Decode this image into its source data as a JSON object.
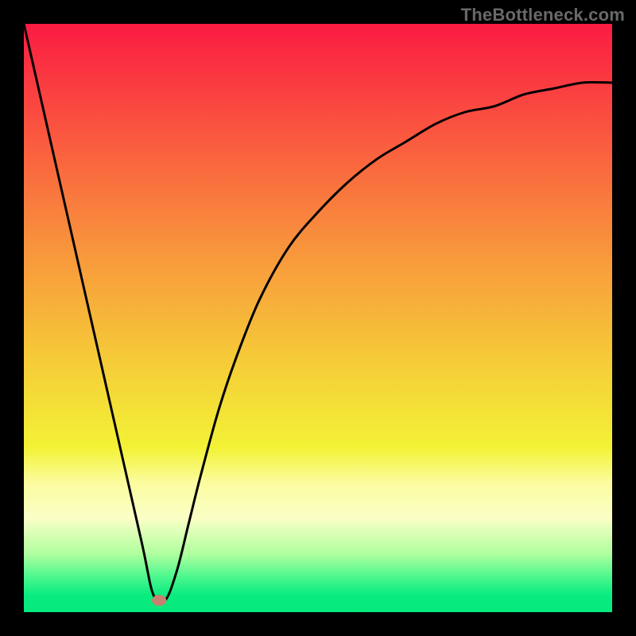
{
  "watermark": "TheBottleneck.com",
  "chart_data": {
    "type": "line",
    "title": "",
    "xlabel": "",
    "ylabel": "",
    "xlim": [
      0,
      100
    ],
    "ylim": [
      0,
      100
    ],
    "grid": false,
    "series": [
      {
        "name": "curve",
        "x": [
          0,
          5,
          10,
          15,
          20,
          22,
          24,
          26,
          28,
          30,
          33,
          36,
          40,
          45,
          50,
          55,
          60,
          65,
          70,
          75,
          80,
          85,
          90,
          95,
          100
        ],
        "y": [
          100,
          78,
          56,
          34,
          12,
          3,
          2,
          7,
          15,
          23,
          34,
          43,
          53,
          62,
          68,
          73,
          77,
          80,
          83,
          85,
          86,
          88,
          89,
          90,
          90
        ]
      }
    ],
    "marker": {
      "x": 23,
      "y": 2,
      "color": "#c88070"
    },
    "gradient_stops": [
      {
        "offset": 0.0,
        "color": "#fb1b43"
      },
      {
        "offset": 0.2,
        "color": "#fa5b3f"
      },
      {
        "offset": 0.4,
        "color": "#f89a3c"
      },
      {
        "offset": 0.6,
        "color": "#f5d337"
      },
      {
        "offset": 0.72,
        "color": "#f3f235"
      },
      {
        "offset": 0.78,
        "color": "#fbfc9f"
      },
      {
        "offset": 0.84,
        "color": "#faffc6"
      },
      {
        "offset": 0.9,
        "color": "#b1ff9f"
      },
      {
        "offset": 0.94,
        "color": "#4cf78e"
      },
      {
        "offset": 0.97,
        "color": "#0bec80"
      },
      {
        "offset": 1.0,
        "color": "#04e97d"
      }
    ]
  }
}
